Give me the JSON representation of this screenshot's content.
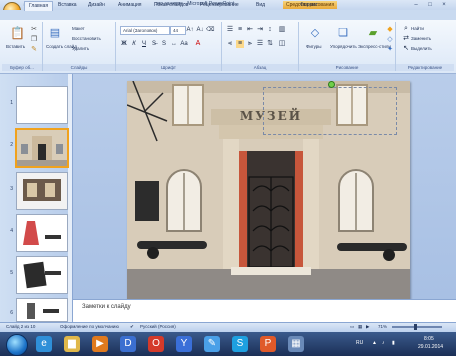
{
  "window": {
    "title": "это занятие - Microsoft PowerPoint",
    "context_tab_title": "Средства рисования",
    "minimize": "–",
    "maximize": "□",
    "close": "×"
  },
  "tabs": [
    "Главная",
    "Вставка",
    "Дизайн",
    "Анимация",
    "Показ слайдов",
    "Рецензирование",
    "Вид",
    "Формат"
  ],
  "ribbon": {
    "clipboard": {
      "paste": "Вставить",
      "label": "Буфер об..."
    },
    "slides": {
      "layout": "Макет",
      "reset": "Восстановить",
      "create": "Создать слайд",
      "delete": "Удалить",
      "label": "Слайды"
    },
    "font": {
      "font_name": "Arial (Заголовок)",
      "font_size": "44",
      "bold": "Ж",
      "italic": "К",
      "underline": "Ч",
      "label": "Шрифт"
    },
    "paragraph": {
      "label": "Абзац"
    },
    "drawing": {
      "shapes": "Фигуры",
      "arrange": "Упорядочить",
      "quick_styles": "Экспресс-стили",
      "label": "Рисование"
    },
    "editing": {
      "find": "Найти",
      "replace": "Заменить",
      "select": "Выделить",
      "label": "Редактирование"
    }
  },
  "slides": {
    "numbers": [
      "1",
      "2",
      "3",
      "4",
      "5",
      "6"
    ],
    "selected_index": 1
  },
  "slide_content": {
    "sign": "МУЗЕЙ"
  },
  "notes": {
    "placeholder": "Заметки к слайду"
  },
  "status": {
    "slide_info": "Слайд 2 из 10",
    "theme": "Оформление по умолчанию",
    "language": "Русский (Россия)",
    "zoom": "71%"
  },
  "taskbar": {
    "lang": "RU",
    "time": "8:05",
    "date": "29.01.2014"
  },
  "colors": {
    "accent": "#f0a21e",
    "ribbon": "#dce8f7",
    "taskbar": "#1b2f56"
  }
}
